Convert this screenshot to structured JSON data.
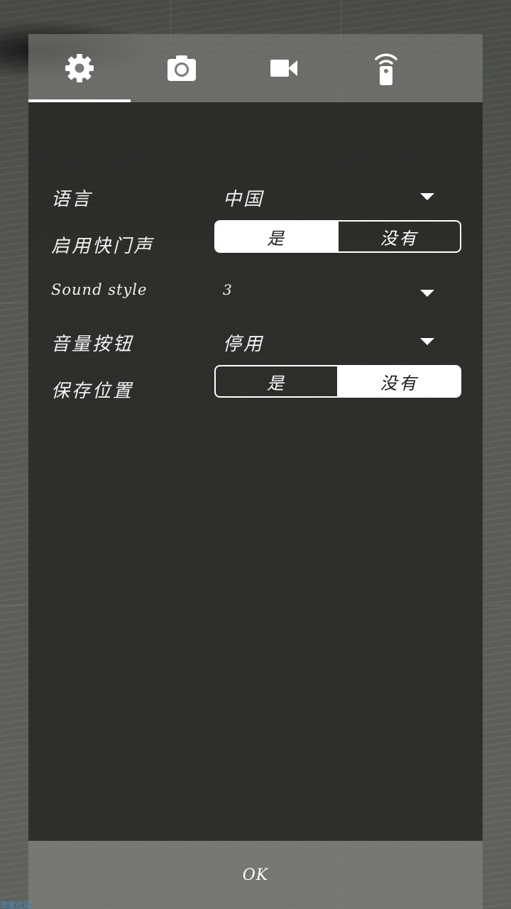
{
  "tabs": [
    {
      "name": "settings",
      "icon": "gear-icon",
      "active": true
    },
    {
      "name": "photo",
      "icon": "camera-icon",
      "active": false
    },
    {
      "name": "video",
      "icon": "video-camera-icon",
      "active": false
    },
    {
      "name": "remote",
      "icon": "remote-icon",
      "active": false
    }
  ],
  "settings": {
    "language": {
      "label": "语言",
      "value": "中国"
    },
    "shutter_sound": {
      "label": "启用快门声",
      "yes": "是",
      "no": "没有",
      "selected": "yes"
    },
    "sound_style": {
      "label": "Sound style",
      "value": "3"
    },
    "volume_button": {
      "label": "音量按钮",
      "value": "停用"
    },
    "save_location": {
      "label": "保存位置",
      "yes": "是",
      "no": "没有",
      "selected": "no"
    }
  },
  "footer": {
    "ok_label": "OK"
  },
  "watermark": {
    "text": "流星社区"
  },
  "colors": {
    "accent": "#ffffff",
    "panel": "#262824",
    "tabbar": "#787a76"
  }
}
